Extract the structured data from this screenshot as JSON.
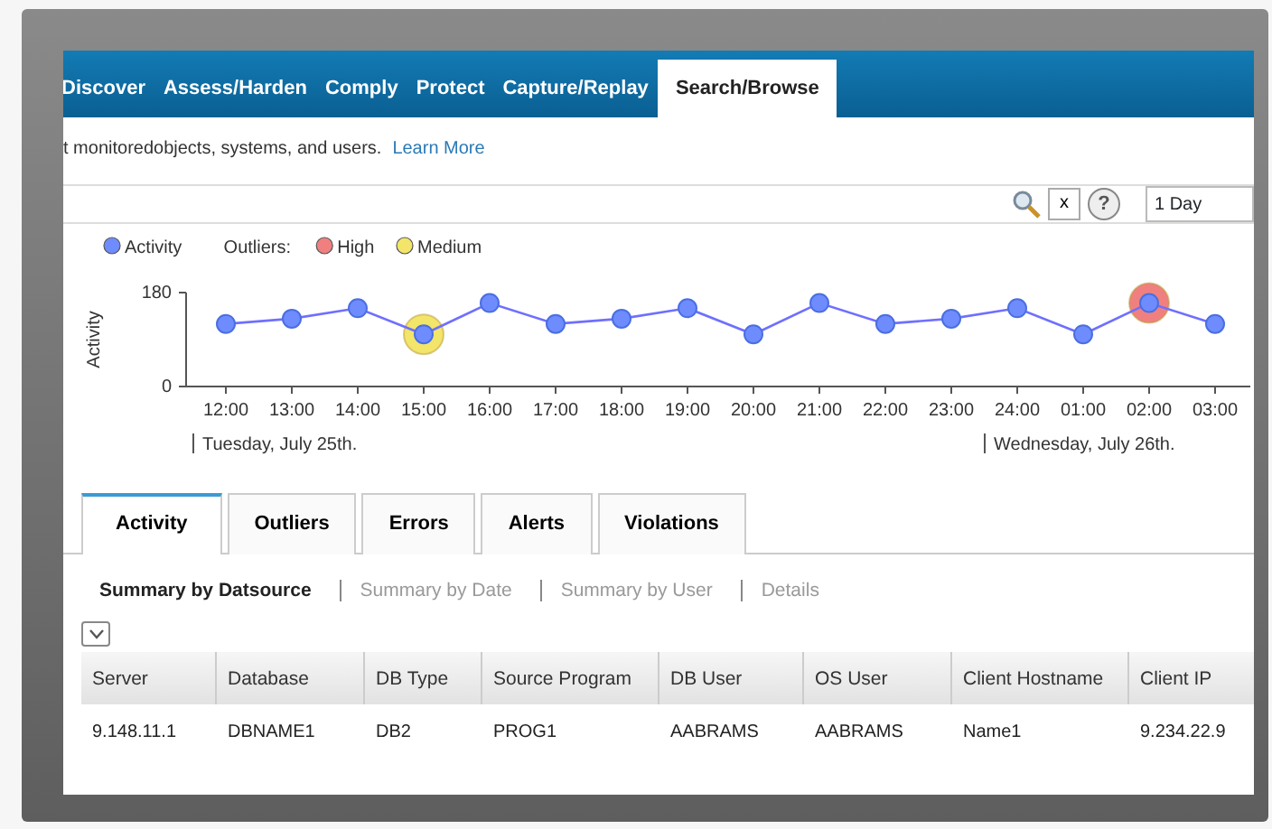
{
  "nav_tabs": [
    {
      "label": "Discover",
      "selected": false
    },
    {
      "label": "Assess/Harden",
      "selected": false
    },
    {
      "label": "Comply",
      "selected": false
    },
    {
      "label": "Protect",
      "selected": false
    },
    {
      "label": "Capture/Replay",
      "selected": false
    },
    {
      "label": "Search/Browse",
      "selected": true
    }
  ],
  "info": {
    "text": "t monitoredobjects, systems, and users.",
    "link": "Learn More"
  },
  "toolbar": {
    "clear": "x",
    "help": "?",
    "range": "1 Day"
  },
  "chart": {
    "outliers_label": "Outliers:",
    "outlier_legend": [
      {
        "label": "High",
        "color": "#f08080"
      },
      {
        "label": "Medium",
        "color": "#f2e56a"
      }
    ],
    "points": [
      {
        "high": false,
        "medium": false
      },
      {
        "high": false,
        "medium": false
      },
      {
        "high": false,
        "medium": false
      },
      {
        "high": false,
        "medium": true
      },
      {
        "high": false,
        "medium": false
      },
      {
        "high": false,
        "medium": false
      },
      {
        "high": false,
        "medium": false
      },
      {
        "high": false,
        "medium": false
      },
      {
        "high": false,
        "medium": false
      },
      {
        "high": false,
        "medium": false
      },
      {
        "high": false,
        "medium": false
      },
      {
        "high": false,
        "medium": false
      },
      {
        "high": false,
        "medium": false
      },
      {
        "high": false,
        "medium": false
      },
      {
        "high": true,
        "medium": false
      },
      {
        "high": false,
        "medium": false
      }
    ],
    "dates": [
      "Tuesday, July 25th.",
      "Wednesday, July 26th."
    ],
    "chart_data": {
      "type": "line",
      "ylabel": "Activity",
      "categories": [
        "12:00",
        "13:00",
        "14:00",
        "15:00",
        "16:00",
        "17:00",
        "18:00",
        "19:00",
        "20:00",
        "21:00",
        "22:00",
        "23:00",
        "24:00",
        "01:00",
        "02:00",
        "03:00"
      ],
      "series": [
        {
          "name": "Activity",
          "color": "#6f8cff",
          "marker": "circle",
          "values": [
            120,
            130,
            150,
            100,
            160,
            120,
            130,
            150,
            100,
            160,
            120,
            130,
            150,
            100,
            160,
            120
          ]
        }
      ],
      "ylim": [
        0,
        180
      ],
      "yticks": [
        0,
        180
      ]
    }
  },
  "tabs": [
    {
      "label": "Activity",
      "selected": true
    },
    {
      "label": "Outliers",
      "selected": false
    },
    {
      "label": "Errors",
      "selected": false
    },
    {
      "label": "Alerts",
      "selected": false
    },
    {
      "label": "Violations",
      "selected": false
    }
  ],
  "subtabs": [
    {
      "label": "Summary by Datsource",
      "selected": true
    },
    {
      "label": "Summary by Date",
      "selected": false
    },
    {
      "label": "Summary by User",
      "selected": false
    },
    {
      "label": "Details",
      "selected": false
    }
  ],
  "table": {
    "columns": [
      "Server",
      "Database",
      "DB Type",
      "Source Program",
      "DB User",
      "OS User",
      "Client Hostname",
      "Client IP"
    ],
    "rows": [
      [
        "9.148.11.1",
        "DBNAME1",
        "DB2",
        "PROG1",
        "AABRAMS",
        "AABRAMS",
        "Name1",
        "9.234.22.9"
      ]
    ]
  }
}
